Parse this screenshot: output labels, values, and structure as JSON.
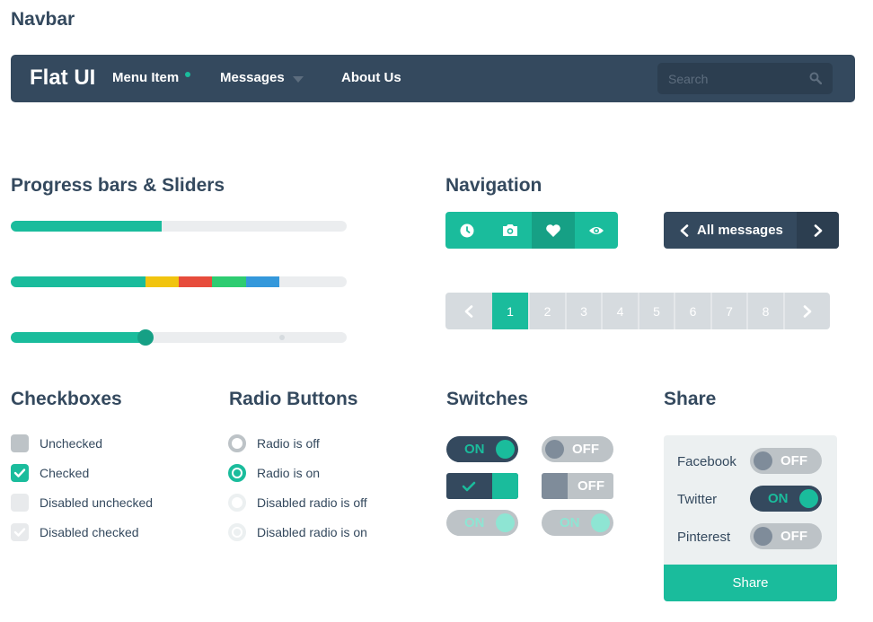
{
  "headings": {
    "navbar": "Navbar",
    "progress": "Progress bars & Sliders",
    "navigation": "Navigation",
    "checkboxes": "Checkboxes",
    "radios": "Radio Buttons",
    "switches": "Switches",
    "share": "Share"
  },
  "navbar": {
    "brand": "Flat UI",
    "items": [
      "Menu Item",
      "Messages",
      "About Us"
    ],
    "search_placeholder": "Search"
  },
  "progress": {
    "bar1_value": 0.45,
    "bar2_segments": [
      0.4,
      0.1,
      0.1,
      0.1,
      0.1
    ],
    "slider_value": 0.4
  },
  "navigation": {
    "icons": [
      "clock-icon",
      "camera-icon",
      "heart-icon",
      "eye-icon"
    ],
    "active_icon": "heart-icon",
    "all_messages": "All messages",
    "pages": [
      "1",
      "2",
      "3",
      "4",
      "5",
      "6",
      "7",
      "8"
    ],
    "active_page": "1"
  },
  "checkboxes": [
    {
      "label": "Unchecked",
      "state": "unchecked"
    },
    {
      "label": "Checked",
      "state": "checked"
    },
    {
      "label": "Disabled unchecked",
      "state": "disabled-unchecked"
    },
    {
      "label": "Disabled checked",
      "state": "disabled-checked"
    }
  ],
  "radios": [
    {
      "label": "Radio is off",
      "state": "off"
    },
    {
      "label": "Radio is on",
      "state": "on"
    },
    {
      "label": "Disabled radio is off",
      "state": "disabled-off"
    },
    {
      "label": "Disabled radio is on",
      "state": "disabled-on"
    }
  ],
  "switches": {
    "on": "ON",
    "off": "OFF"
  },
  "share": {
    "networks": [
      {
        "name": "Facebook",
        "state": "OFF"
      },
      {
        "name": "Twitter",
        "state": "ON"
      },
      {
        "name": "Pinterest",
        "state": "OFF"
      }
    ],
    "button": "Share"
  },
  "colors": {
    "turquoise": "#1abc9c",
    "green_sea": "#16a085",
    "wet_asphalt": "#34495e",
    "midnight": "#2c3e50",
    "sunflower": "#f1c40f",
    "alizarin": "#e74c3c",
    "emerald": "#2ecc71",
    "peter_river": "#3498db",
    "clouds": "#ecf0f1",
    "silver": "#bdc3c7"
  }
}
